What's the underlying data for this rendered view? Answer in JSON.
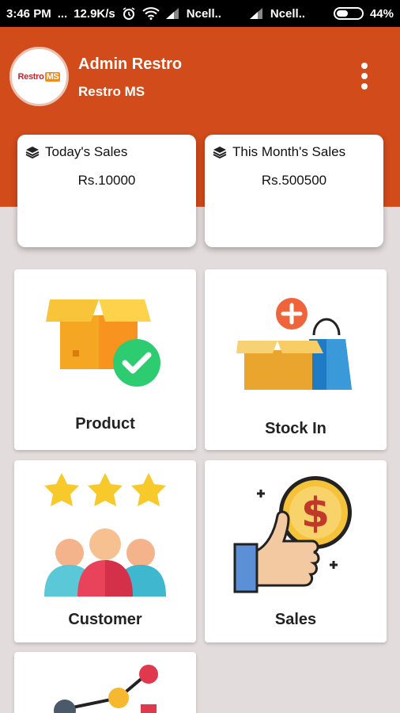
{
  "status_bar": {
    "time": "3:46 PM",
    "dots": "...",
    "speed": "12.9K/s",
    "carrier1": "Ncell..",
    "carrier2": "Ncell..",
    "battery": "44%"
  },
  "header": {
    "logo_text_a": "Restro",
    "logo_text_b": "MS",
    "user_name": "Admin Restro",
    "app_name": "Restro MS"
  },
  "sales_cards": [
    {
      "title": "Today's Sales",
      "amount": "Rs.10000",
      "icon": "layers-icon"
    },
    {
      "title": "This Month's Sales",
      "amount": "Rs.500500",
      "icon": "layers-icon"
    }
  ],
  "tiles": [
    {
      "label": "Product",
      "icon": "box-check-icon"
    },
    {
      "label": "Stock In",
      "icon": "box-bag-plus-icon"
    },
    {
      "label": "Customer",
      "icon": "customers-stars-icon"
    },
    {
      "label": "Sales",
      "icon": "thumbs-up-dollar-icon"
    },
    {
      "label": "",
      "icon": "chart-icon"
    }
  ],
  "colors": {
    "header": "#d24b1a",
    "background": "#e3dcdc"
  }
}
